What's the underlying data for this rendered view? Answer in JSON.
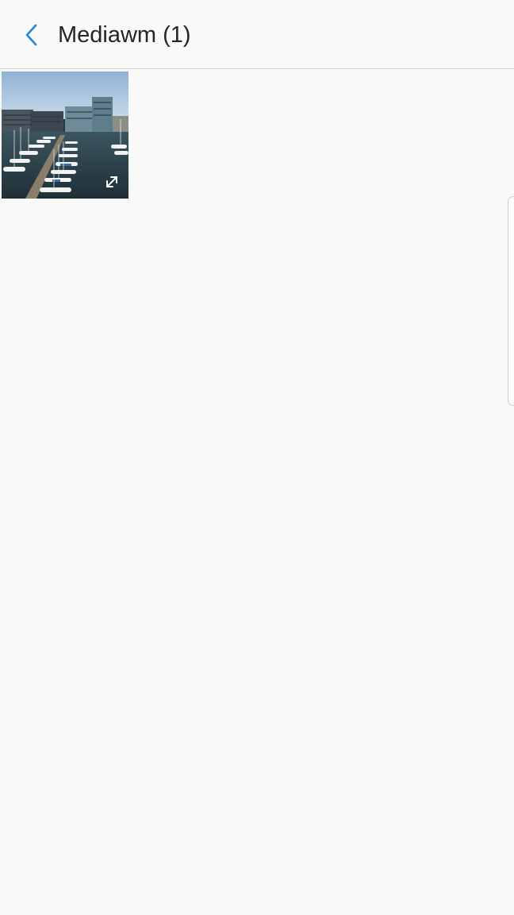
{
  "header": {
    "title": "Mediawm (1)",
    "back_icon": "chevron-left-icon",
    "accent_color": "#1e88d6"
  },
  "gallery": {
    "items": [
      {
        "type": "image",
        "subject": "marina",
        "overlay_icon": "expand-icon"
      }
    ]
  },
  "edge_panel": {
    "icon": "edge-handle"
  }
}
